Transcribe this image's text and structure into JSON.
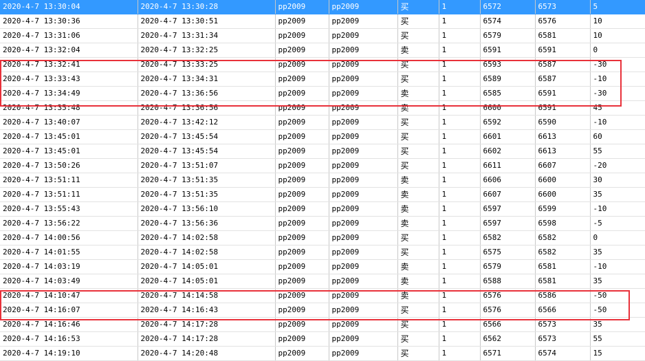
{
  "colors": {
    "selection": "#3399ff",
    "highlight_border": "#e8313a"
  },
  "trades": [
    [
      "2020-4-7 13:30:04",
      "2020-4-7 13:30:28",
      "pp2009",
      "pp2009",
      "买",
      "1",
      "6572",
      "6573",
      "5"
    ],
    [
      "2020-4-7 13:30:36",
      "2020-4-7 13:30:51",
      "pp2009",
      "pp2009",
      "买",
      "1",
      "6574",
      "6576",
      "10"
    ],
    [
      "2020-4-7 13:31:06",
      "2020-4-7 13:31:34",
      "pp2009",
      "pp2009",
      "买",
      "1",
      "6579",
      "6581",
      "10"
    ],
    [
      "2020-4-7 13:32:04",
      "2020-4-7 13:32:25",
      "pp2009",
      "pp2009",
      "卖",
      "1",
      "6591",
      "6591",
      "0"
    ],
    [
      "2020-4-7 13:32:41",
      "2020-4-7 13:33:25",
      "pp2009",
      "pp2009",
      "买",
      "1",
      "6593",
      "6587",
      "-30"
    ],
    [
      "2020-4-7 13:33:43",
      "2020-4-7 13:34:31",
      "pp2009",
      "pp2009",
      "买",
      "1",
      "6589",
      "6587",
      "-10"
    ],
    [
      "2020-4-7 13:34:49",
      "2020-4-7 13:36:56",
      "pp2009",
      "pp2009",
      "卖",
      "1",
      "6585",
      "6591",
      "-30"
    ],
    [
      "2020-4-7 13:35:48",
      "2020-4-7 13:36:56",
      "pp2009",
      "pp2009",
      "卖",
      "1",
      "6600",
      "6591",
      "45"
    ],
    [
      "2020-4-7 13:40:07",
      "2020-4-7 13:42:12",
      "pp2009",
      "pp2009",
      "买",
      "1",
      "6592",
      "6590",
      "-10"
    ],
    [
      "2020-4-7 13:45:01",
      "2020-4-7 13:45:54",
      "pp2009",
      "pp2009",
      "买",
      "1",
      "6601",
      "6613",
      "60"
    ],
    [
      "2020-4-7 13:45:01",
      "2020-4-7 13:45:54",
      "pp2009",
      "pp2009",
      "买",
      "1",
      "6602",
      "6613",
      "55"
    ],
    [
      "2020-4-7 13:50:26",
      "2020-4-7 13:51:07",
      "pp2009",
      "pp2009",
      "买",
      "1",
      "6611",
      "6607",
      "-20"
    ],
    [
      "2020-4-7 13:51:11",
      "2020-4-7 13:51:35",
      "pp2009",
      "pp2009",
      "卖",
      "1",
      "6606",
      "6600",
      "30"
    ],
    [
      "2020-4-7 13:51:11",
      "2020-4-7 13:51:35",
      "pp2009",
      "pp2009",
      "卖",
      "1",
      "6607",
      "6600",
      "35"
    ],
    [
      "2020-4-7 13:55:43",
      "2020-4-7 13:56:10",
      "pp2009",
      "pp2009",
      "卖",
      "1",
      "6597",
      "6599",
      "-10"
    ],
    [
      "2020-4-7 13:56:22",
      "2020-4-7 13:56:36",
      "pp2009",
      "pp2009",
      "卖",
      "1",
      "6597",
      "6598",
      "-5"
    ],
    [
      "2020-4-7 14:00:56",
      "2020-4-7 14:02:58",
      "pp2009",
      "pp2009",
      "买",
      "1",
      "6582",
      "6582",
      "0"
    ],
    [
      "2020-4-7 14:01:55",
      "2020-4-7 14:02:58",
      "pp2009",
      "pp2009",
      "买",
      "1",
      "6575",
      "6582",
      "35"
    ],
    [
      "2020-4-7 14:03:19",
      "2020-4-7 14:05:01",
      "pp2009",
      "pp2009",
      "卖",
      "1",
      "6579",
      "6581",
      "-10"
    ],
    [
      "2020-4-7 14:03:49",
      "2020-4-7 14:05:01",
      "pp2009",
      "pp2009",
      "卖",
      "1",
      "6588",
      "6581",
      "35"
    ],
    [
      "2020-4-7 14:10:47",
      "2020-4-7 14:14:58",
      "pp2009",
      "pp2009",
      "卖",
      "1",
      "6576",
      "6586",
      "-50"
    ],
    [
      "2020-4-7 14:16:07",
      "2020-4-7 14:16:43",
      "pp2009",
      "pp2009",
      "买",
      "1",
      "6576",
      "6566",
      "-50"
    ],
    [
      "2020-4-7 14:16:46",
      "2020-4-7 14:17:28",
      "pp2009",
      "pp2009",
      "买",
      "1",
      "6566",
      "6573",
      "35"
    ],
    [
      "2020-4-7 14:16:53",
      "2020-4-7 14:17:28",
      "pp2009",
      "pp2009",
      "买",
      "1",
      "6562",
      "6573",
      "55"
    ],
    [
      "2020-4-7 14:19:10",
      "2020-4-7 14:20:48",
      "pp2009",
      "pp2009",
      "买",
      "1",
      "6571",
      "6574",
      "15"
    ]
  ]
}
